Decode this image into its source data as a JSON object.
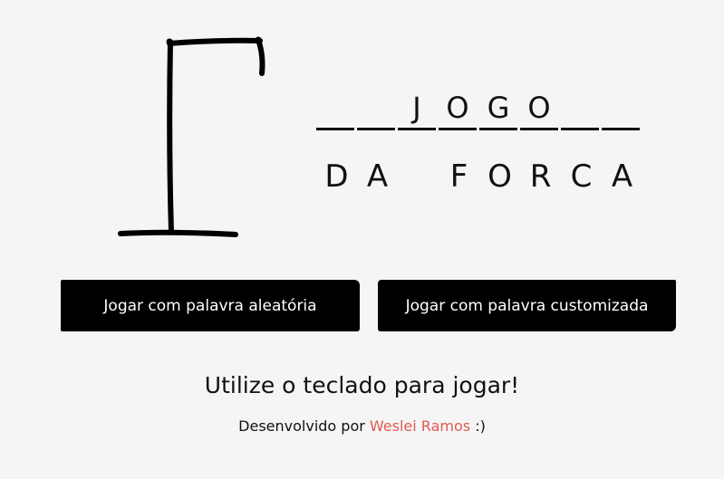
{
  "title": {
    "row1_slots": [
      "",
      "",
      "J",
      "O",
      "G",
      "O",
      "",
      ""
    ],
    "row2_letters": [
      "D",
      "A",
      "",
      "F",
      "O",
      "R",
      "C",
      "A"
    ]
  },
  "buttons": {
    "random_label": "Jogar com palavra aleatória",
    "custom_label": "Jogar com palavra customizada"
  },
  "instruction": "Utilize o teclado para jogar!",
  "footer": {
    "prefix": "Desenvolvido por",
    "author": "Weslei Ramos",
    "suffix": ":)"
  },
  "colors": {
    "background": "#f5f5f5",
    "button": "#000000",
    "author_link": "#e05a4f"
  }
}
